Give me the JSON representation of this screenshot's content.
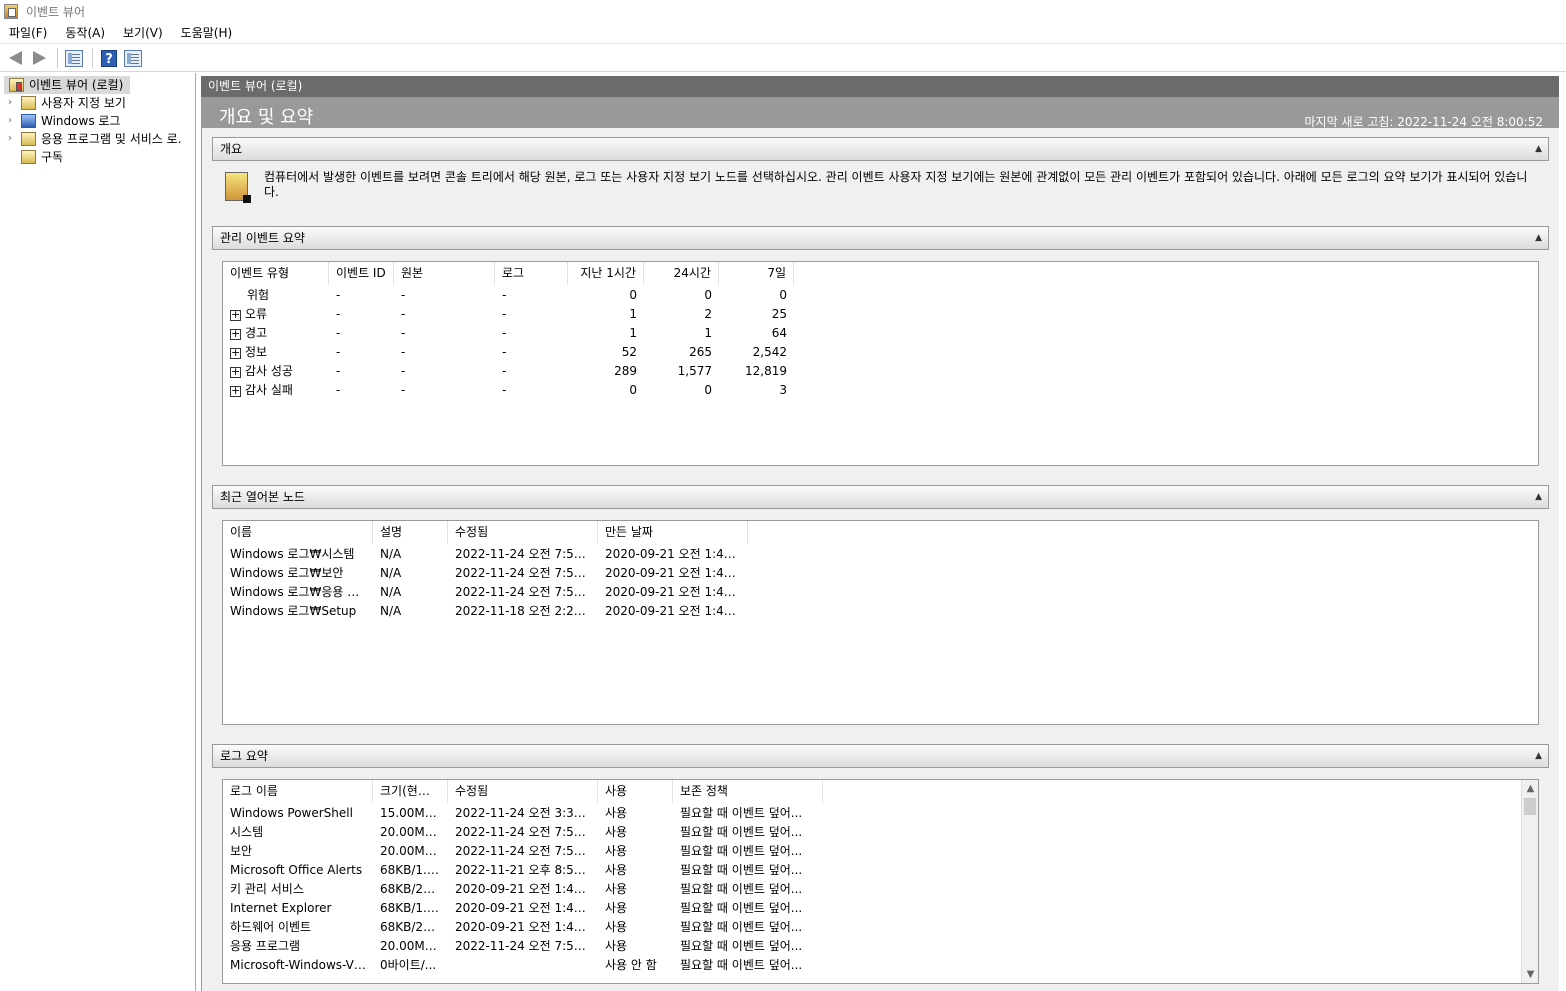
{
  "window": {
    "title": "이벤트 뷰어"
  },
  "menus": [
    "파일(F)",
    "동작(A)",
    "보기(V)",
    "도움말(H)"
  ],
  "toolbar": {
    "help_label": "?"
  },
  "tree": {
    "root": "이벤트 뷰어 (로컬)",
    "items": [
      {
        "label": "사용자 지정 보기",
        "expandable": true,
        "icon": "folder-icon"
      },
      {
        "label": "Windows 로그",
        "expandable": true,
        "icon": "folder-icon"
      },
      {
        "label": "응용 프로그램 및 서비스 로.",
        "expandable": true,
        "icon": "folder-icon"
      },
      {
        "label": "구독",
        "expandable": false,
        "icon": "subscription-icon"
      }
    ]
  },
  "content": {
    "header": "이벤트 뷰어 (로컬)",
    "title": "개요 및 요약",
    "last_refresh": "마지막 새로 고침: 2022-11-24 오전 8:00:52",
    "overview": {
      "title": "개요",
      "text": "컴퓨터에서 발생한 이벤트를 보려면 콘솔 트리에서 해당 원본, 로그 또는 사용자 지정 보기 노드를 선택하십시오. 관리 이벤트 사용자 지정 보기에는 원본에 관계없이 모든 관리 이벤트가 포함되어 있습니다. 아래에 모든 로그의 요약 보기가 표시되어 있습니다."
    },
    "admin_summary": {
      "title": "관리 이벤트 요약",
      "columns": [
        "이벤트 유형",
        "이벤트 ID",
        "원본",
        "로그",
        "지난 1시간",
        "24시간",
        "7일"
      ],
      "rows": [
        {
          "type": "위험",
          "expand": false,
          "event_id": "-",
          "source": "-",
          "log": "-",
          "last_hour": "0",
          "day": "0",
          "week": "0"
        },
        {
          "type": "오류",
          "expand": true,
          "event_id": "-",
          "source": "-",
          "log": "-",
          "last_hour": "1",
          "day": "2",
          "week": "25"
        },
        {
          "type": "경고",
          "expand": true,
          "event_id": "-",
          "source": "-",
          "log": "-",
          "last_hour": "1",
          "day": "1",
          "week": "64"
        },
        {
          "type": "정보",
          "expand": true,
          "event_id": "-",
          "source": "-",
          "log": "-",
          "last_hour": "52",
          "day": "265",
          "week": "2,542"
        },
        {
          "type": "감사 성공",
          "expand": true,
          "event_id": "-",
          "source": "-",
          "log": "-",
          "last_hour": "289",
          "day": "1,577",
          "week": "12,819"
        },
        {
          "type": "감사 실패",
          "expand": true,
          "event_id": "-",
          "source": "-",
          "log": "-",
          "last_hour": "0",
          "day": "0",
          "week": "3"
        }
      ]
    },
    "recent_nodes": {
      "title": "최근 열어본 노드",
      "columns": [
        "이름",
        "설명",
        "수정됨",
        "만든 날짜"
      ],
      "rows": [
        {
          "name": "Windows 로그₩시스템",
          "description": "N/A",
          "modified": "2022-11-24 오전 7:59:...",
          "created": "2020-09-21 오전 1:45:..."
        },
        {
          "name": "Windows 로그₩보안",
          "description": "N/A",
          "modified": "2022-11-24 오전 7:57:...",
          "created": "2020-09-21 오전 1:45:..."
        },
        {
          "name": "Windows 로그₩응용 프...",
          "description": "N/A",
          "modified": "2022-11-24 오전 7:59:...",
          "created": "2020-09-21 오전 1:45:..."
        },
        {
          "name": "Windows 로그₩Setup",
          "description": "N/A",
          "modified": "2022-11-18 오전 2:20:...",
          "created": "2020-09-21 오전 1:45:..."
        }
      ]
    },
    "log_summary": {
      "title": "로그 요약",
      "columns": [
        "로그 이름",
        "크기(현재...",
        "수정됨",
        "사용",
        "보존 정책"
      ],
      "rows": [
        {
          "name": "Windows PowerShell",
          "size": "15.00MB/...",
          "modified": "2022-11-24 오전 3:34:...",
          "enabled": "사용",
          "retention": "필요할 때 이벤트 덮어..."
        },
        {
          "name": "시스템",
          "size": "20.00MB/...",
          "modified": "2022-11-24 오전 7:59:...",
          "enabled": "사용",
          "retention": "필요할 때 이벤트 덮어..."
        },
        {
          "name": "보안",
          "size": "20.00MB/...",
          "modified": "2022-11-24 오전 7:57:...",
          "enabled": "사용",
          "retention": "필요할 때 이벤트 덮어..."
        },
        {
          "name": "Microsoft Office Alerts",
          "size": "68KB/1.0...",
          "modified": "2022-11-21 오후 8:54:...",
          "enabled": "사용",
          "retention": "필요할 때 이벤트 덮어..."
        },
        {
          "name": "키 관리 서비스",
          "size": "68KB/20...",
          "modified": "2020-09-21 오전 1:46:...",
          "enabled": "사용",
          "retention": "필요할 때 이벤트 덮어..."
        },
        {
          "name": "Internet Explorer",
          "size": "68KB/1.0...",
          "modified": "2020-09-21 오전 1:46:...",
          "enabled": "사용",
          "retention": "필요할 때 이벤트 덮어..."
        },
        {
          "name": "하드웨어 이벤트",
          "size": "68KB/20...",
          "modified": "2020-09-21 오전 1:46:...",
          "enabled": "사용",
          "retention": "필요할 때 이벤트 덮어..."
        },
        {
          "name": "응용 프로그램",
          "size": "20.00MB/...",
          "modified": "2022-11-24 오전 7:59:...",
          "enabled": "사용",
          "retention": "필요할 때 이벤트 덮어..."
        },
        {
          "name": "Microsoft-Windows-Vpn...",
          "size": "0바이트/...",
          "modified": "",
          "enabled": "사용 안 함",
          "retention": "필요할 때 이벤트 덮어..."
        }
      ]
    }
  }
}
